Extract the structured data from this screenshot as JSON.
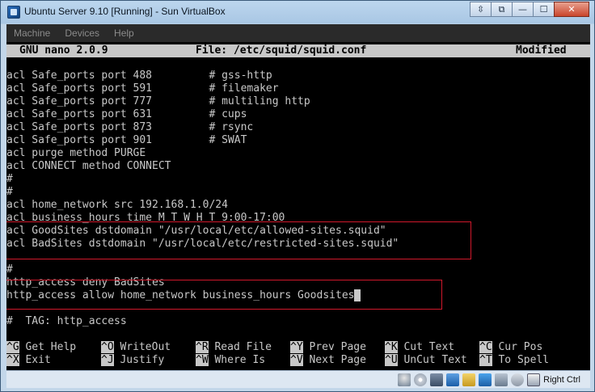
{
  "window": {
    "title": "Ubuntu Server 9.10 [Running] - Sun VirtualBox",
    "buttons": [
      "⇳",
      "⧉",
      "—",
      "☐",
      "✕"
    ]
  },
  "menubar": {
    "items": [
      "Machine",
      "Devices",
      "Help"
    ]
  },
  "nano": {
    "version": "GNU nano 2.0.9",
    "file": "File: /etc/squid/squid.conf",
    "status": "Modified",
    "lines": [
      "acl Safe_ports port 488         # gss-http",
      "acl Safe_ports port 591         # filemaker",
      "acl Safe_ports port 777         # multiling http",
      "acl Safe_ports port 631         # cups",
      "acl Safe_ports port 873         # rsync",
      "acl Safe_ports port 901         # SWAT",
      "acl purge method PURGE",
      "acl CONNECT method CONNECT",
      "#",
      "#",
      "acl home_network src 192.168.1.0/24",
      "acl business_hours time M T W H T 9:00-17:00",
      "acl GoodSites dstdomain \"/usr/local/etc/allowed-sites.squid\"",
      "acl BadSites dstdomain \"/usr/local/etc/restricted-sites.squid\"",
      "",
      "#",
      "http_access deny BadSites",
      "http_access allow home_network business_hours Goodsites",
      "",
      "#  TAG: http_access"
    ],
    "cursor_char": " ",
    "shortcuts_row1": [
      {
        "key": "^G",
        "label": "Get Help"
      },
      {
        "key": "^O",
        "label": "WriteOut"
      },
      {
        "key": "^R",
        "label": "Read File"
      },
      {
        "key": "^Y",
        "label": "Prev Page"
      },
      {
        "key": "^K",
        "label": "Cut Text"
      },
      {
        "key": "^C",
        "label": "Cur Pos"
      }
    ],
    "shortcuts_row2": [
      {
        "key": "^X",
        "label": "Exit"
      },
      {
        "key": "^J",
        "label": "Justify"
      },
      {
        "key": "^W",
        "label": "Where Is"
      },
      {
        "key": "^V",
        "label": "Next Page"
      },
      {
        "key": "^U",
        "label": "UnCut Text"
      },
      {
        "key": "^T",
        "label": "To Spell"
      }
    ]
  },
  "statusbar": {
    "icons": [
      "hard-disk-icon",
      "cd-icon",
      "usb-icon",
      "network-icon",
      "shared-folders-icon",
      "display-icon",
      "virtualization-icon",
      "mouse-integration-icon",
      "host-key-arrow-icon"
    ],
    "host_key": "Right Ctrl"
  },
  "annotation_color": "#d0182b"
}
